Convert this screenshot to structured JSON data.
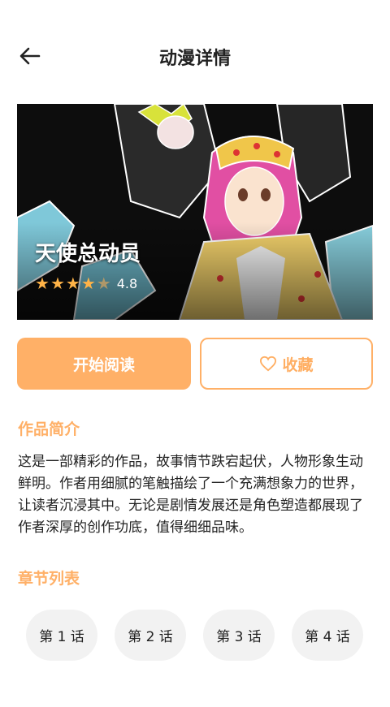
{
  "header": {
    "title": "动漫详情",
    "back_icon": "arrow-left-icon"
  },
  "comic": {
    "title": "天使总动员",
    "rating": 4.8,
    "rating_text": "4.8",
    "stars_full": 4,
    "stars_half": 1
  },
  "actions": {
    "read_label": "开始阅读",
    "favorite_label": "收藏",
    "favorite_icon": "heart-outline-icon"
  },
  "intro": {
    "heading": "作品简介",
    "text": "这是一部精彩的作品，故事情节跌宕起伏，人物形象生动鲜明。作者用细腻的笔触描绘了一个充满想象力的世界，让读者沉浸其中。无论是剧情发展还是角色塑造都展现了作者深厚的创作功底，值得细细品味。"
  },
  "chapters": {
    "heading": "章节列表",
    "items": [
      {
        "label": "第 1 话"
      },
      {
        "label": "第 2 话"
      },
      {
        "label": "第 3 话"
      },
      {
        "label": "第 4 话"
      }
    ]
  },
  "colors": {
    "accent": "#ffb067",
    "chip_bg": "#f2f2f2",
    "star": "#ffb347"
  }
}
